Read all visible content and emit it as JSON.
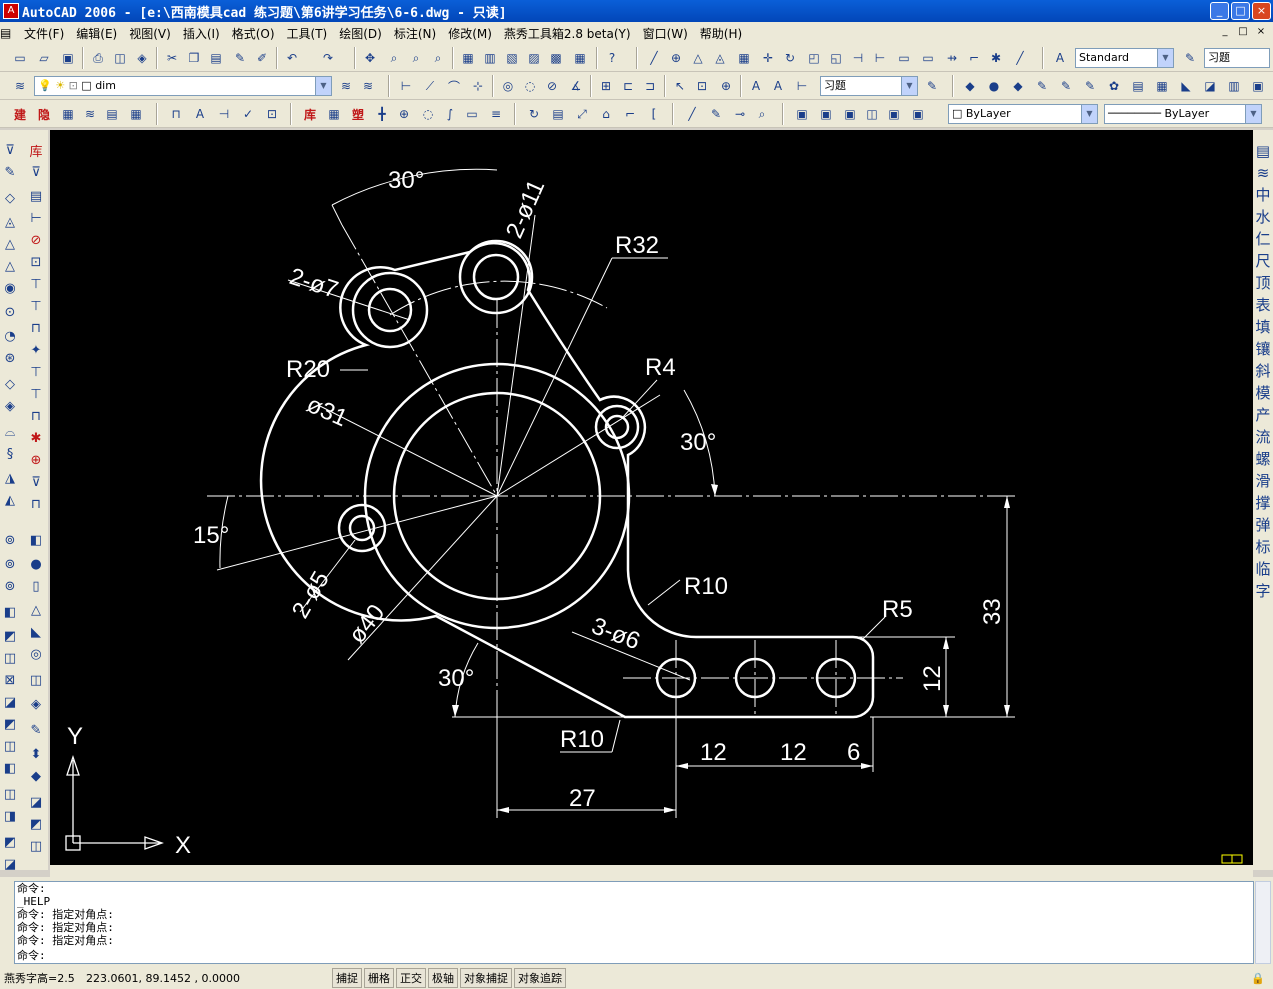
{
  "window": {
    "title": "AutoCAD 2006 - [e:\\西南模具cad 练习题\\第6讲学习任务\\6-6.dwg - 只读]",
    "buttons": {
      "minimize": "_",
      "maximize": "□",
      "close": "×"
    }
  },
  "menu": {
    "items": [
      "文件(F)",
      "编辑(E)",
      "视图(V)",
      "插入(I)",
      "格式(O)",
      "工具(T)",
      "绘图(D)",
      "标注(N)",
      "修改(M)",
      "燕秀工具箱2.8 beta(Y)",
      "窗口(W)",
      "帮助(H)"
    ]
  },
  "toolbar": {
    "text_style": "Standard",
    "dim_style": "习题",
    "layer_name": "dim",
    "table_style": "习题",
    "color": "ByLayer",
    "linetype": "ByLayer",
    "row3_red_labels": [
      "建",
      "隐"
    ],
    "row3b_red_labels": [
      "库",
      "塑"
    ]
  },
  "left_palette": {
    "library_label": "库"
  },
  "right_palette": {
    "items": [
      "中",
      "水",
      "仁",
      "尺",
      "顶",
      "表",
      "填",
      "镶",
      "斜",
      "模",
      "产",
      "流",
      "螺",
      "滑",
      "撑",
      "弹",
      "标",
      "临",
      "字"
    ]
  },
  "drawing": {
    "labels": {
      "ang_top": "30°",
      "hole11": "2-ø11",
      "r32": "R32",
      "hole7": "2-ø7",
      "r20": "R20",
      "r4": "R4",
      "d31": "ø31",
      "ang_right": "30°",
      "ang_left": "15°",
      "hole5": "2-ø5",
      "d40": "ø40",
      "r10_upper": "R10",
      "hole6": "3-ø6",
      "r5": "R5",
      "dim33": "33",
      "dim12_v": "12",
      "ang_bottom": "30°",
      "r10_lower": "R10",
      "dim12_a": "12",
      "dim12_b": "12",
      "dim6": "6",
      "dim27": "27"
    },
    "ucs": {
      "y": "Y",
      "x": "X"
    }
  },
  "command": {
    "lines": [
      "命令:",
      "_HELP",
      "命令: 指定对角点:",
      "命令: 指定对角点:",
      "命令: 指定对角点:"
    ],
    "prompt": "命令:"
  },
  "status": {
    "font_height": "燕秀字高=2.5",
    "coords": "223.0601, 89.1452 , 0.0000",
    "toggles": [
      "捕捉",
      "栅格",
      "正交",
      "极轴",
      "对象捕捉",
      "对象追踪"
    ]
  },
  "colors": {
    "canvas": "#000000",
    "title": "#0a5fd8",
    "chrome": "#ece9d8"
  }
}
